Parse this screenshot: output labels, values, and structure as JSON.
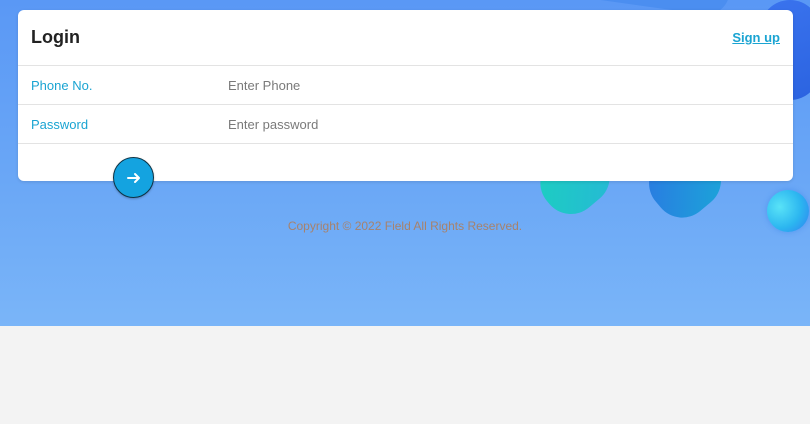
{
  "login": {
    "title": "Login",
    "signup_link": "Sign up",
    "fields": [
      {
        "label": "Phone No.",
        "placeholder": "Enter Phone",
        "value": ""
      },
      {
        "label": "Password",
        "placeholder": "Enter password",
        "value": ""
      }
    ],
    "submit_icon": "arrow-right-icon"
  },
  "footer": {
    "copyright": "Copyright © 2022 Field All Rights Reserved."
  },
  "colors": {
    "accent": "#1aa4d2",
    "button": "#14a3e0",
    "background_top": "#5a98f5",
    "background_bottom": "#7ab5f8",
    "copyright_text": "#a7826c"
  }
}
